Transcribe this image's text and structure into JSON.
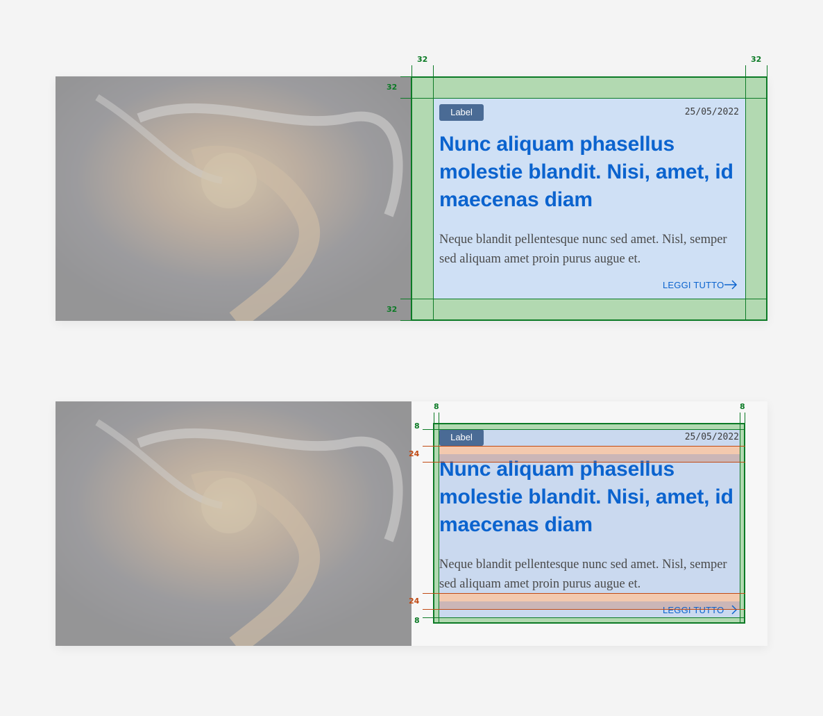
{
  "cards": [
    {
      "label": "Label",
      "date": "25/05/2022",
      "title": "Nunc aliquam phasellus molestie blandit. Nisi, amet, id maecenas diam",
      "description": "Neque blandit pellentesque nunc sed amet. Nisl, semper sed aliquam amet proin purus augue et.",
      "cta": "LEGGI TUTTO",
      "cta_icon": "arrow-right-icon"
    },
    {
      "label": "Label",
      "date": "25/05/2022",
      "title": "Nunc aliquam phasellus molestie blandit. Nisi, amet, id maecenas diam",
      "description": "Neque blandit pellentesque nunc sed amet. Nisl, semper sed aliquam amet proin purus augue et.",
      "cta": "LEGGI TUTTO",
      "cta_icon": "chevron-right-icon"
    }
  ],
  "spec1": {
    "padding_top": "32",
    "padding_bottom": "32",
    "padding_left": "32",
    "padding_right": "32"
  },
  "spec2": {
    "padding_top": "8",
    "padding_bottom": "8",
    "padding_left": "8",
    "padding_right": "8",
    "gap_after_header": "24",
    "gap_before_cta": "24"
  },
  "colors": {
    "padding_overlay": "#b2d9b1",
    "content_overlay": "#cfe0f5",
    "spacing_overlay": "#f3c9ae",
    "label_bg": "#4a6b95",
    "accent": "#0b63ce",
    "measure_line": "#0b7a25",
    "gap_line": "#c14a14"
  }
}
